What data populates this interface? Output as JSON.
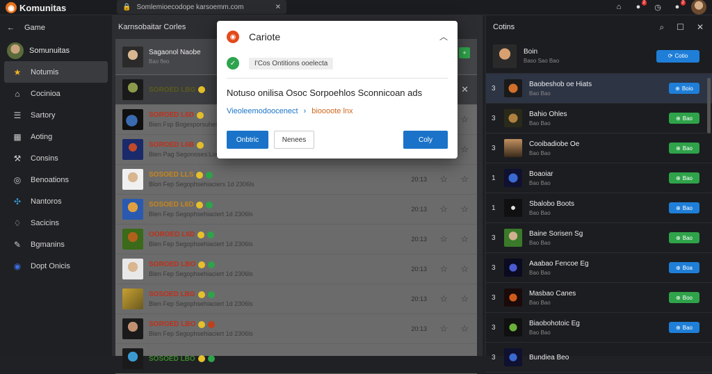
{
  "topbar": {
    "brand": "Komunitas",
    "url": "Somlemioecodope karsoemm.com",
    "badges": [
      "2",
      "2"
    ]
  },
  "sidebar": {
    "header": "Game",
    "user": "Somunuitas",
    "items": [
      {
        "label": "Notumis",
        "icon": "star-icon",
        "active": true
      },
      {
        "label": "Cocinioa",
        "icon": "home-icon"
      },
      {
        "label": "Sartory",
        "icon": "list-icon"
      },
      {
        "label": "Aoting",
        "icon": "building-icon"
      },
      {
        "label": "Consins",
        "icon": "tools-icon"
      },
      {
        "label": "Benoations",
        "icon": "circle-icon"
      },
      {
        "label": "Nantoros",
        "icon": "network-icon"
      },
      {
        "label": "Sacicins",
        "icon": "shield-icon"
      },
      {
        "label": "Bgmanins",
        "icon": "pen-icon"
      },
      {
        "label": "Dopt Onicis",
        "icon": "disc-icon"
      }
    ]
  },
  "center": {
    "header": "Karnsobaitar  Corles",
    "first": {
      "title": "Sagaonol Naobe",
      "sub": "Bao fleo"
    },
    "rows": [
      {
        "title": "SOROED  LBG",
        "sub": "",
        "time": "",
        "color": "#5a5a1c"
      },
      {
        "title": "SOROED  L6D",
        "sub": "Bien Fsp Bogesporsuhess 1d 2306",
        "time": "",
        "color": "#c0301a"
      },
      {
        "title": "SOROED  L6B",
        "sub": "Blen Pag Segonoses:Liaclis 1d 2306s",
        "time": "",
        "color": "#c0301a"
      },
      {
        "title": "SOSOED  LLS",
        "sub": "Blon Fep Segophsehiaciers 1d 2306ls",
        "time": "20:13",
        "color": "#c8861a"
      },
      {
        "title": "SOSOED  L6D",
        "sub": "Blen Fep Segophsehiaciert 1d 2306ls",
        "time": "20:13",
        "color": "#c8861a"
      },
      {
        "title": "OOROED  L6D",
        "sub": "Blen Fep Segophsehiaciert 1d 2306ls",
        "time": "20:13",
        "color": "#c0301a"
      },
      {
        "title": "SOROED  LBO",
        "sub": "Blen Fep Segophsehiaciert 1d 2306ls",
        "time": "20:13",
        "color": "#c0301a"
      },
      {
        "title": "SOSOED  LBG",
        "sub": "Blen Fep Segophsehiaciert 1d 2306ls",
        "time": "20:13",
        "color": "#c0301a"
      },
      {
        "title": "SOROED  LBO",
        "sub": "Blen Fep Segophsehiaciert 1d 2306ls",
        "time": "20:13",
        "color": "#c0301a"
      },
      {
        "title": "SOSOED  LBO",
        "sub": "",
        "time": "",
        "color": "#3a8a2a"
      }
    ]
  },
  "right": {
    "header": "Cotins",
    "top": {
      "title": "Boin",
      "sub": "Baso Sao Bao",
      "btn": "Cotio"
    },
    "rows": [
      {
        "num": "3",
        "title": "Baobeshob oe Hiats",
        "sub": "Bao Bao",
        "btn": "Boio",
        "kind": "blue",
        "sel": true
      },
      {
        "num": "3",
        "title": "Bahio Ohles",
        "sub": "Bao Bao",
        "btn": "Bao",
        "kind": "green"
      },
      {
        "num": "3",
        "title": "Cooibadiobe Oe",
        "sub": "Bao Bao",
        "btn": "Bao",
        "kind": "green"
      },
      {
        "num": "1",
        "title": "Boaoiar",
        "sub": "Bao Bao",
        "btn": "Bao",
        "kind": "green"
      },
      {
        "num": "1",
        "title": "Sbalobo Boots",
        "sub": "Bao Bao",
        "btn": "Bao",
        "kind": "blue"
      },
      {
        "num": "3",
        "title": "Baine Sorisen Sg",
        "sub": "Bao Bao",
        "btn": "Bao",
        "kind": "green"
      },
      {
        "num": "3",
        "title": "Aaabao Fencoe Eg",
        "sub": "Bao Bao",
        "btn": "Boa",
        "kind": "blue"
      },
      {
        "num": "3",
        "title": "Masbao Canes",
        "sub": "Bao Bao",
        "btn": "Boo",
        "kind": "green"
      },
      {
        "num": "3",
        "title": "Biaobohotoic Eg",
        "sub": "Bao Bao",
        "btn": "Bao",
        "kind": "blue"
      },
      {
        "num": "3",
        "title": "Bundiea  Beo",
        "sub": "",
        "btn": "",
        "kind": ""
      }
    ]
  },
  "modal": {
    "title": "Cariote",
    "status": "I'Cos Ontitions ooelecta",
    "message": "Notuso onilisa Osoc Sorpoehlos Sconnicoan ads",
    "link1": "Vieoleemodoocenect",
    "link2": "bioooote lnx",
    "btn_primary": "Onbtric",
    "btn_secondary": "Nenees",
    "btn_ok": "Coly"
  },
  "colors": {
    "accent": "#1a73c8",
    "green": "#2fa34a",
    "brand": "#e8701a"
  }
}
